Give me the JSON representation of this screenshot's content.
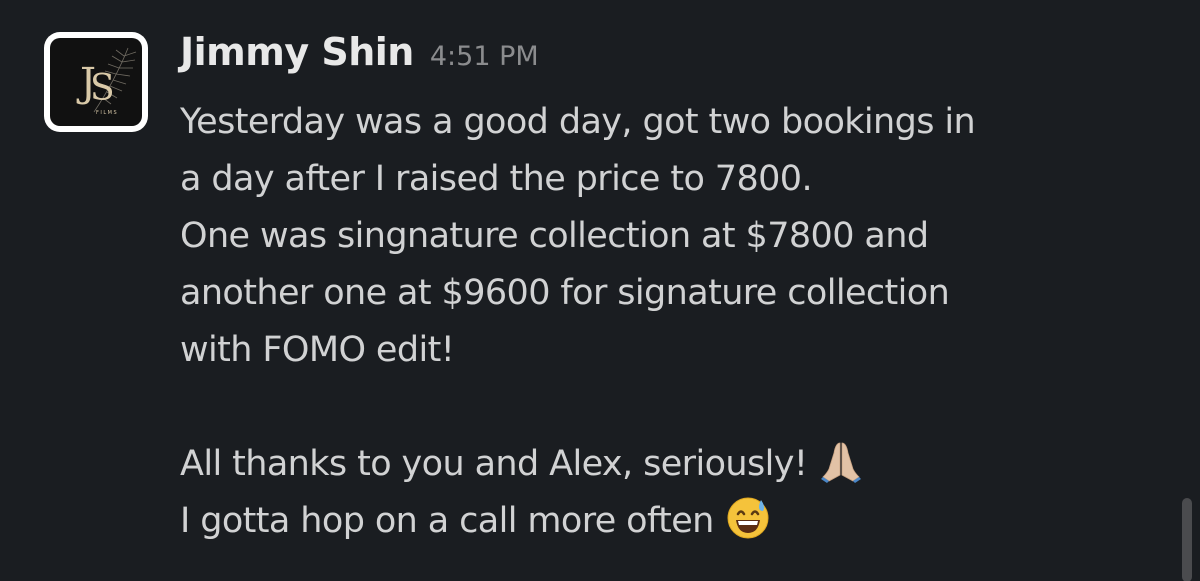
{
  "message": {
    "sender": "Jimmy Shin",
    "time": "4:51 PM",
    "avatar_monogram": "JS",
    "avatar_sublabel": "FILMS",
    "lines": [
      "Yesterday was a good day, got two bookings in",
      "a day after I raised the price to 7800.",
      "One was singnature collection at $7800 and",
      "another one at $9600 for signature collection",
      "with FOMO edit!",
      "",
      "All thanks to you and Alex, seriously!",
      "I gotta hop on a call more often"
    ],
    "emojis": {
      "line7": "folded-hands-emoji",
      "line8": "grinning-face-with-sweat-emoji"
    }
  },
  "colors": {
    "background": "#1a1d21",
    "text": "#d1d2d3",
    "sender": "#e8e8e8",
    "timestamp": "#8b8c8e"
  }
}
